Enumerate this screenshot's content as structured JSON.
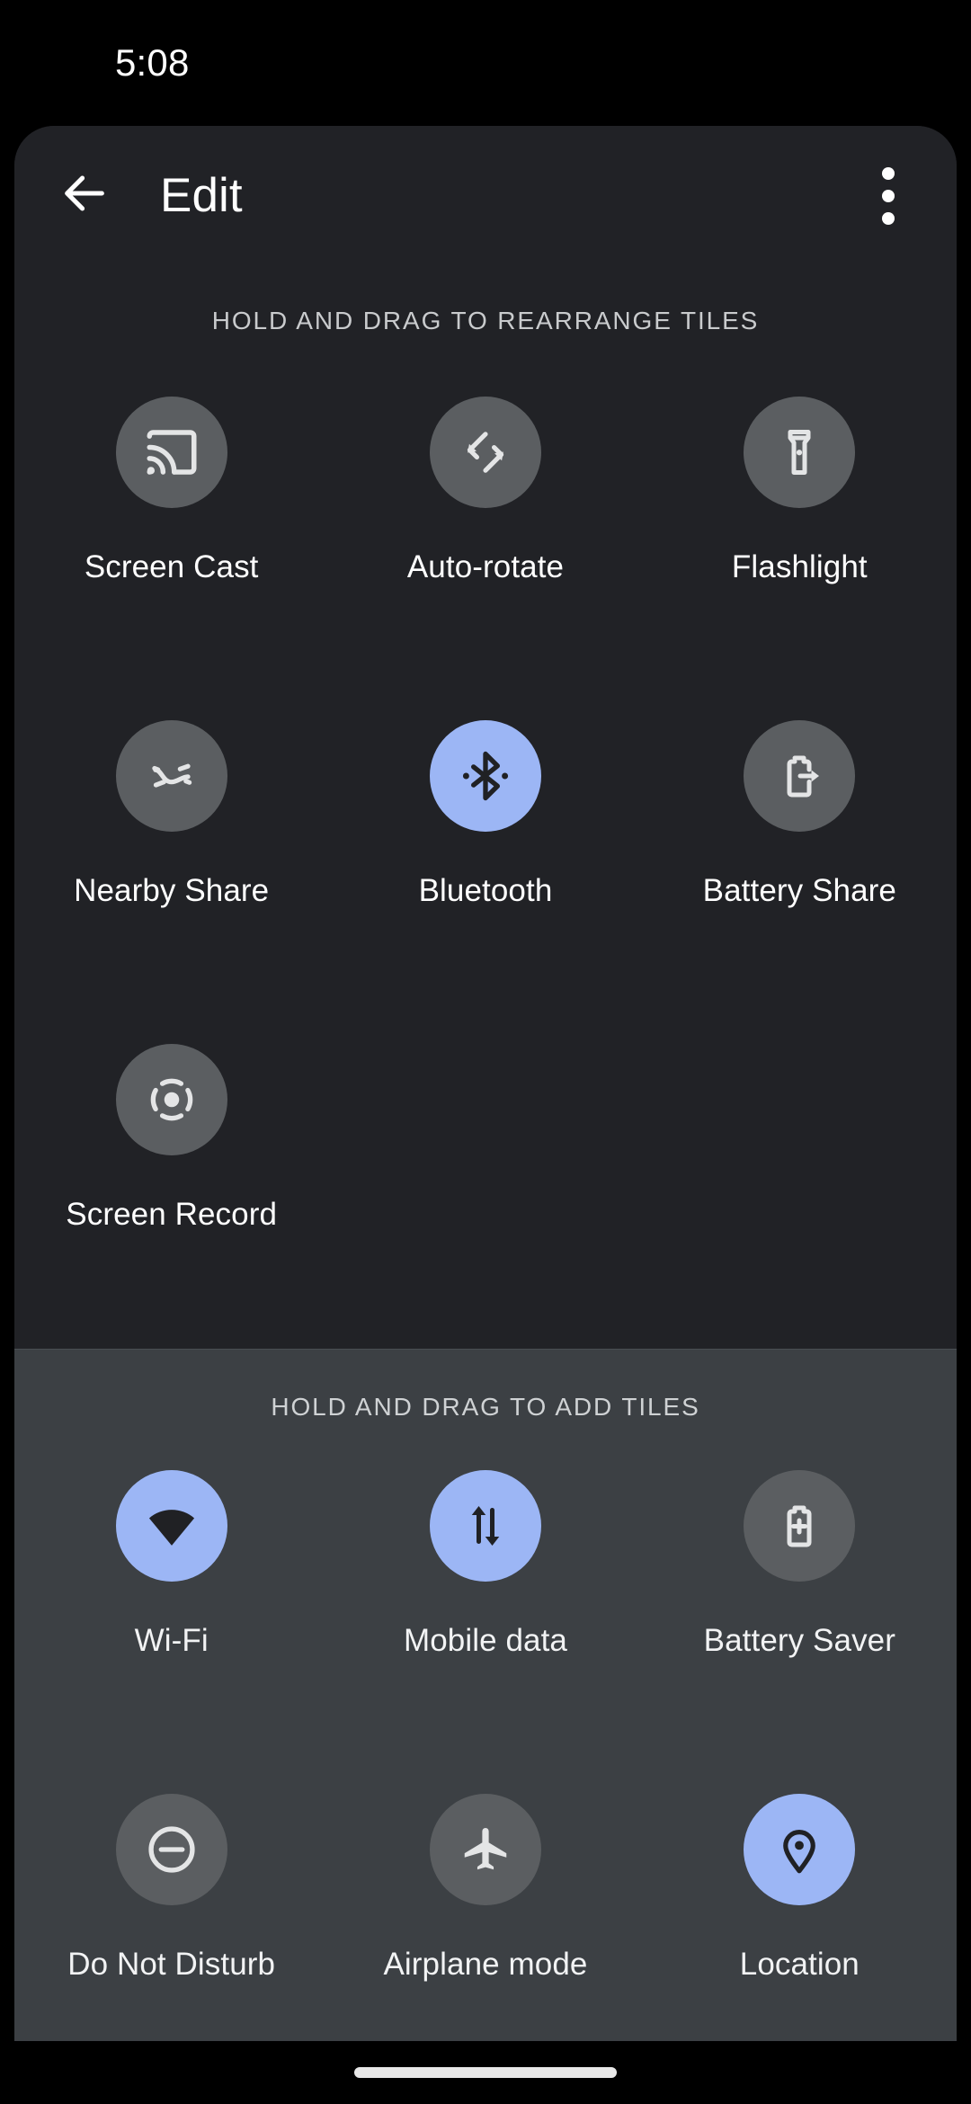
{
  "status_bar": {
    "time": "5:08"
  },
  "toolbar": {
    "back_label": "back-arrow",
    "title": "Edit",
    "overflow_label": "More options"
  },
  "colors": {
    "background": "#000000",
    "panel": "#212226",
    "add_section": "#3c4044",
    "tile_inactive": "#5b5e61",
    "tile_active": "#9cb6f5",
    "icon_inactive": "#e4e5e6",
    "icon_active": "#202124",
    "text_primary": "#ffffff",
    "text_secondary": "#c9cbcd"
  },
  "current_section": {
    "header": "HOLD AND DRAG TO REARRANGE TILES",
    "tiles": [
      {
        "label": "Screen Cast",
        "icon": "screen-cast-icon",
        "active": false
      },
      {
        "label": "Auto-rotate",
        "icon": "auto-rotate-icon",
        "active": false
      },
      {
        "label": "Flashlight",
        "icon": "flashlight-icon",
        "active": false
      },
      {
        "label": "Nearby Share",
        "icon": "nearby-share-icon",
        "active": false
      },
      {
        "label": "Bluetooth",
        "icon": "bluetooth-icon",
        "active": true
      },
      {
        "label": "Battery Share",
        "icon": "battery-share-icon",
        "active": false
      },
      {
        "label": "Screen Record",
        "icon": "screen-record-icon",
        "active": false
      }
    ]
  },
  "add_section": {
    "header": "HOLD AND DRAG TO ADD TILES",
    "tiles": [
      {
        "label": "Wi-Fi",
        "icon": "wifi-icon",
        "active": true
      },
      {
        "label": "Mobile data",
        "icon": "mobile-data-icon",
        "active": true
      },
      {
        "label": "Battery Saver",
        "icon": "battery-saver-icon",
        "active": false
      },
      {
        "label": "Do Not Disturb",
        "icon": "do-not-disturb-icon",
        "active": false
      },
      {
        "label": "Airplane mode",
        "icon": "airplane-mode-icon",
        "active": false
      },
      {
        "label": "Location",
        "icon": "location-pin-icon",
        "active": true
      }
    ]
  },
  "nav_bar": {
    "home_indicator": "home-indicator"
  }
}
